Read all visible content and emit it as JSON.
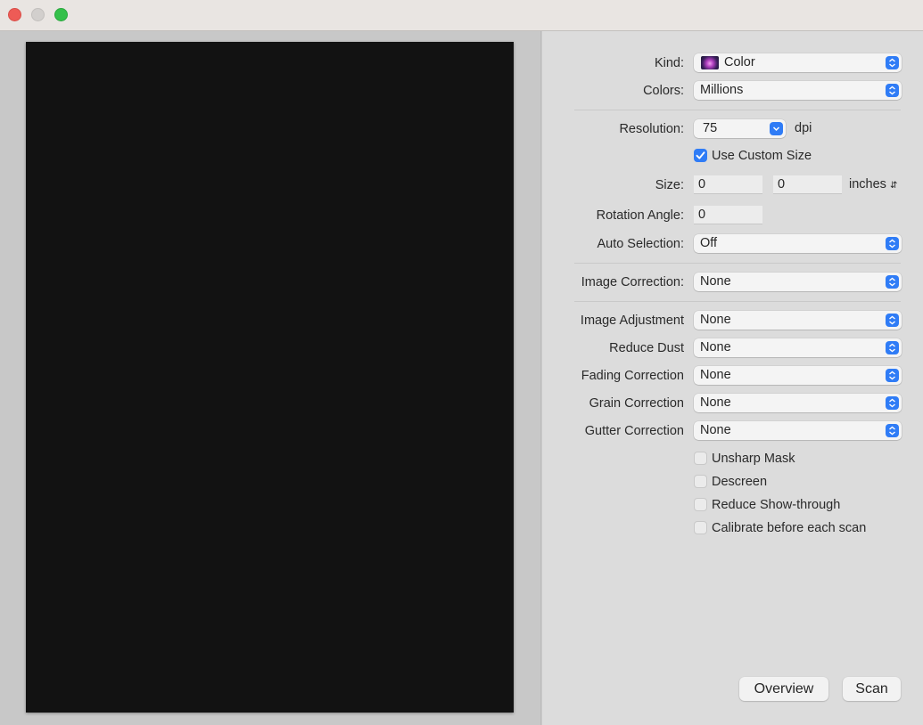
{
  "window": {
    "controls": [
      "close",
      "minimize",
      "maximize"
    ]
  },
  "preview": {
    "background": "#121212"
  },
  "settings": {
    "kind": {
      "label": "Kind:",
      "value": "Color",
      "icon": "color-photo-icon"
    },
    "colors": {
      "label": "Colors:",
      "value": "Millions"
    },
    "resolution": {
      "label": "Resolution:",
      "value": "75",
      "unit": "dpi"
    },
    "use_custom_size": {
      "label": "Use Custom Size",
      "checked": true
    },
    "size": {
      "label": "Size:",
      "width": "0",
      "height": "0",
      "unit": "inches"
    },
    "rotation_angle": {
      "label": "Rotation Angle:",
      "value": "0"
    },
    "auto_selection": {
      "label": "Auto Selection:",
      "value": "Off"
    },
    "image_correction": {
      "label": "Image Correction:",
      "value": "None"
    },
    "image_adjustment": {
      "label": "Image Adjustment",
      "value": "None"
    },
    "reduce_dust": {
      "label": "Reduce Dust",
      "value": "None"
    },
    "fading_correction": {
      "label": "Fading Correction",
      "value": "None"
    },
    "grain_correction": {
      "label": "Grain Correction",
      "value": "None"
    },
    "gutter_correction": {
      "label": "Gutter Correction",
      "value": "None"
    },
    "checkboxes": [
      {
        "label": "Unsharp Mask",
        "checked": false
      },
      {
        "label": "Descreen",
        "checked": false
      },
      {
        "label": "Reduce Show-through",
        "checked": false
      },
      {
        "label": "Calibrate before each scan",
        "checked": false
      }
    ]
  },
  "buttons": {
    "overview": "Overview",
    "scan": "Scan"
  },
  "colors": {
    "accent": "#2f7cf6",
    "close": "#ee5b56",
    "maximize": "#34c04a"
  }
}
